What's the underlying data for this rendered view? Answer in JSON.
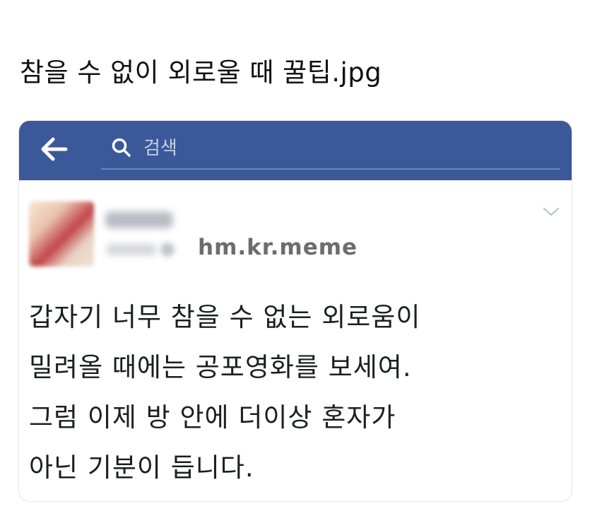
{
  "page": {
    "title": "참을 수 없이 외로울 때 꿀팁.jpg"
  },
  "topbar": {
    "background": "#3b5998",
    "back_icon": "arrow-left-icon",
    "search_icon": "search-icon",
    "search_placeholder": "검색"
  },
  "post": {
    "watermark": "hm.kr.meme",
    "menu_icon": "chevron-down-icon",
    "lines": [
      "갑자기 너무 참을 수 없는 외로움이",
      "밀려올 때에는 공포영화를 보세여.",
      "그럼 이제 방 안에 더이상 혼자가",
      "아닌 기분이 듭니다."
    ]
  }
}
